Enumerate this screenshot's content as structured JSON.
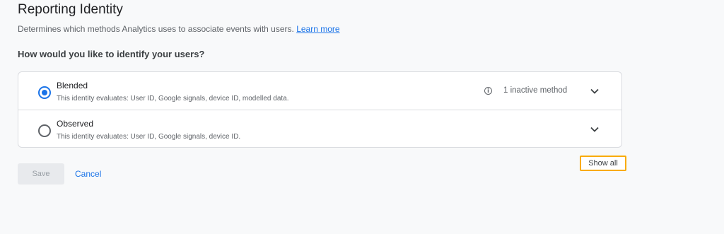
{
  "header": {
    "title": "Reporting Identity",
    "description": "Determines which methods Analytics uses to associate events with users.",
    "learn_more": "Learn more"
  },
  "question": "How would you like to identify your users?",
  "options": [
    {
      "label": "Blended",
      "sub": "This identity evaluates: User ID, Google signals, device ID, modelled data.",
      "info": "1 inactive method",
      "selected": true,
      "icon": "info-icon"
    },
    {
      "label": "Observed",
      "sub": "This identity evaluates: User ID, Google signals, device ID.",
      "selected": false
    }
  ],
  "show_all": "Show all",
  "actions": {
    "save": "Save",
    "cancel": "Cancel"
  },
  "colors": {
    "accent": "#1a73e8",
    "highlight": "#f9ab00"
  }
}
